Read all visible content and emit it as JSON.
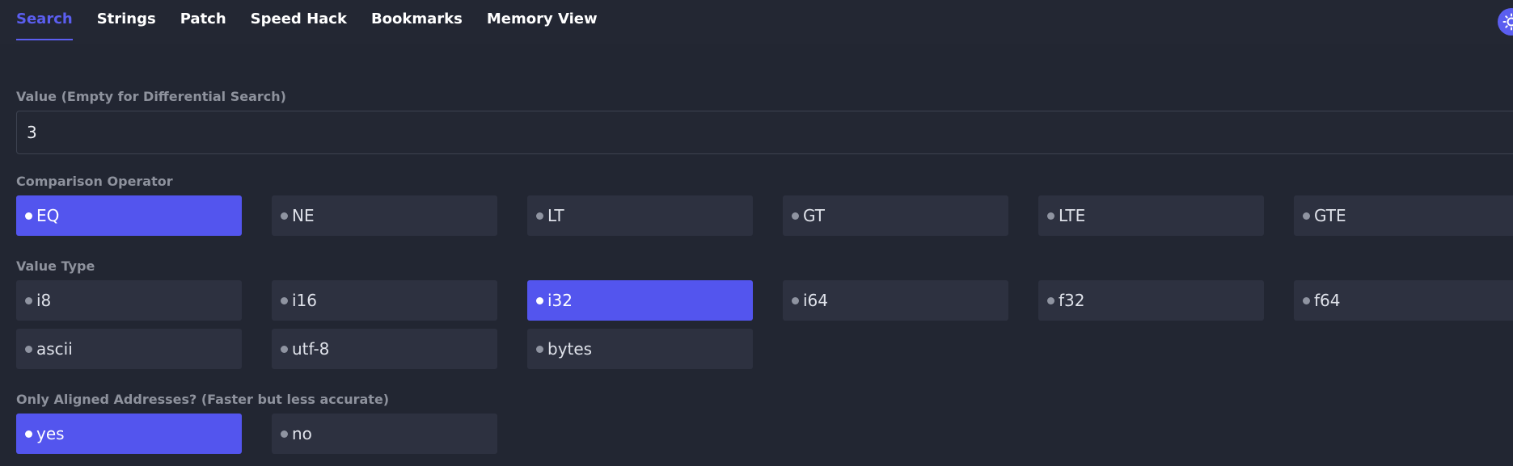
{
  "tabs": [
    {
      "label": "Search",
      "active": true
    },
    {
      "label": "Strings",
      "active": false
    },
    {
      "label": "Patch",
      "active": false
    },
    {
      "label": "Speed Hack",
      "active": false
    },
    {
      "label": "Bookmarks",
      "active": false
    },
    {
      "label": "Memory View",
      "active": false
    }
  ],
  "theme_toggle": {
    "icon": "sun-icon"
  },
  "value_field": {
    "label": "Value (Empty for Differential Search)",
    "value": "3"
  },
  "comparison": {
    "label": "Comparison Operator",
    "options": [
      "EQ",
      "NE",
      "LT",
      "GT",
      "LTE",
      "GTE"
    ],
    "selected": "EQ"
  },
  "value_type": {
    "label": "Value Type",
    "options": [
      "i8",
      "i16",
      "i32",
      "i64",
      "f32",
      "f64",
      "ascii",
      "utf-8",
      "bytes"
    ],
    "selected": "i32"
  },
  "aligned": {
    "label": "Only Aligned Addresses? (Faster but less accurate)",
    "options": [
      "yes",
      "no"
    ],
    "selected": "yes"
  },
  "colors": {
    "accent": "#5355ee",
    "background": "#222632",
    "option_bg": "#2d3140",
    "label_text": "#8e929d"
  }
}
